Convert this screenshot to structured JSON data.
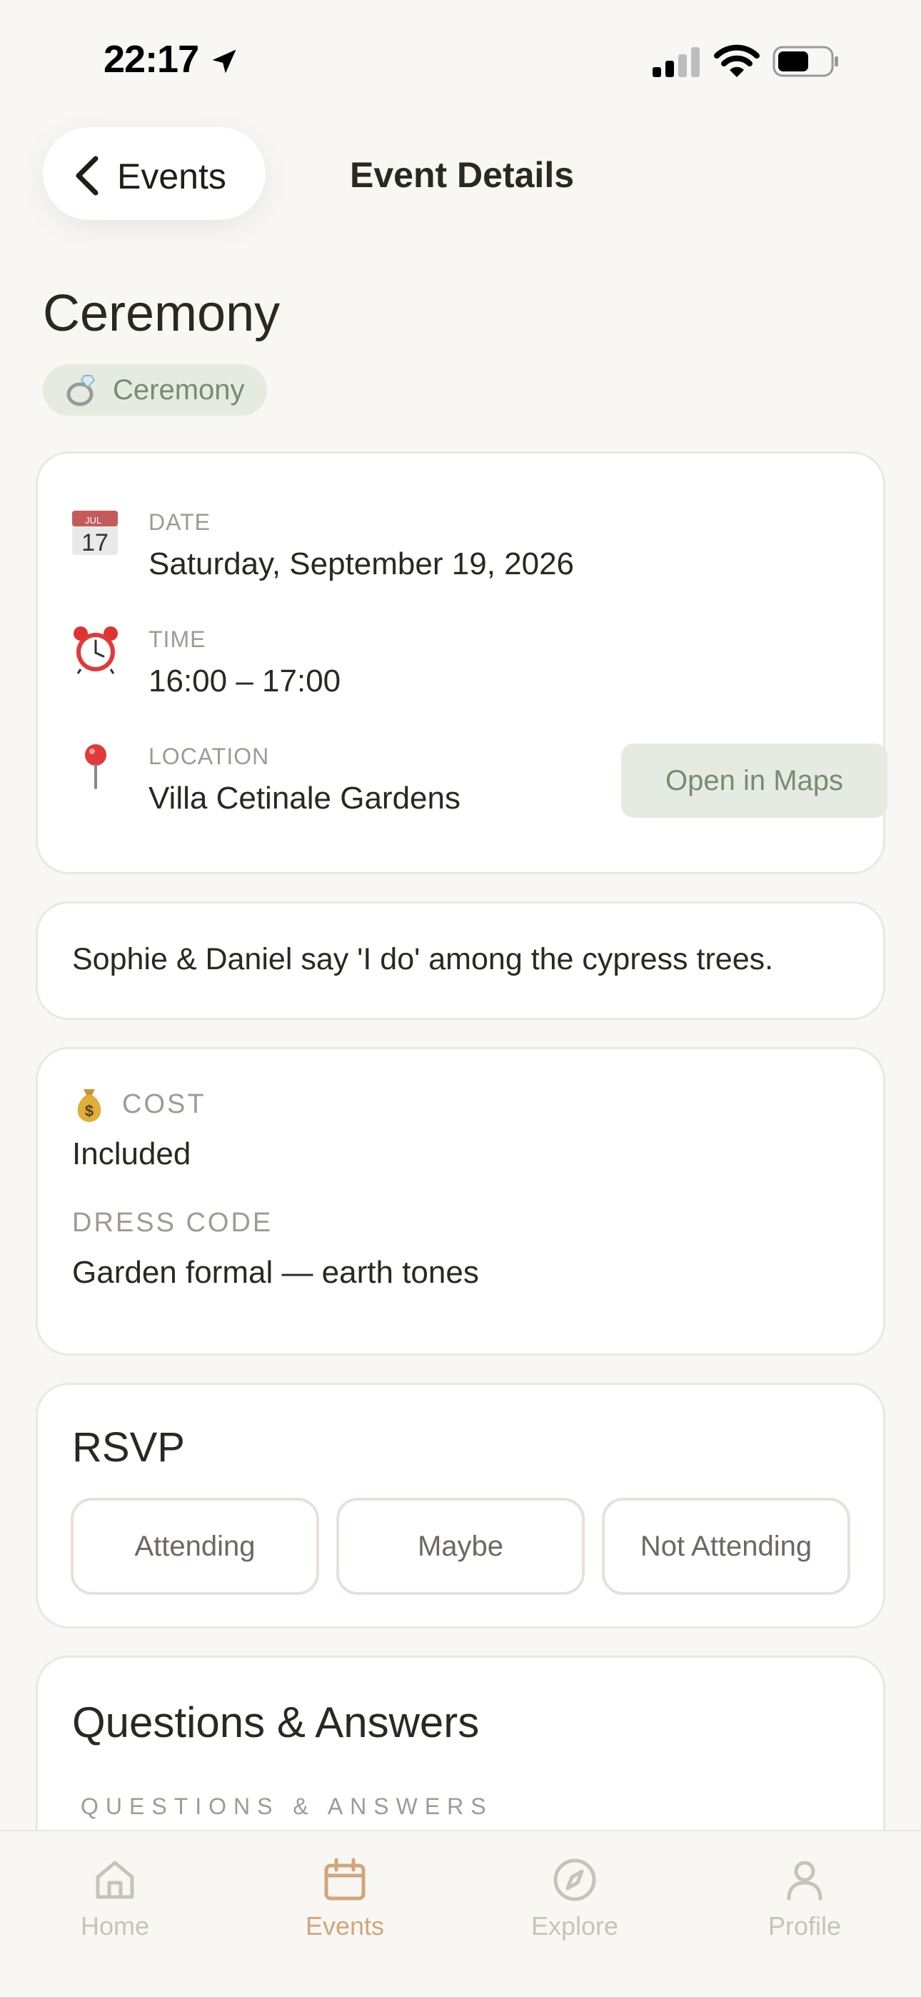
{
  "status_bar": {
    "time": "22:17",
    "icons": [
      "location-arrow-icon",
      "cellular-signal-icon",
      "wifi-icon",
      "battery-icon"
    ]
  },
  "nav": {
    "back_label": "Events",
    "title": "Event Details"
  },
  "event": {
    "title": "Ceremony",
    "category_label": "Ceremony",
    "category_icon": "ring-icon"
  },
  "details": {
    "date": {
      "label": "DATE",
      "value": "Saturday, September 19, 2026",
      "icon": "calendar-icon",
      "icon_month": "JUL",
      "icon_day": "17"
    },
    "time": {
      "label": "TIME",
      "value": "16:00 – 17:00",
      "icon": "alarm-clock-icon"
    },
    "location": {
      "label": "LOCATION",
      "value": "Villa Cetinale Gardens",
      "icon": "map-pin-icon"
    },
    "maps_button": "Open in Maps"
  },
  "description": "Sophie & Daniel say 'I do' among the cypress trees.",
  "cost": {
    "label": "COST",
    "value": "Included",
    "icon": "money-bag-icon",
    "dress_code_label": "DRESS CODE",
    "dress_code_value": "Garden formal — earth tones"
  },
  "rsvp": {
    "title": "RSVP",
    "options": [
      "Attending",
      "Maybe",
      "Not Attending"
    ]
  },
  "qa": {
    "title": "Questions & Answers",
    "subtitle": "QUESTIONS & ANSWERS"
  },
  "tab_bar": {
    "active": "Events",
    "tabs": [
      {
        "label": "Home",
        "icon": "home-icon"
      },
      {
        "label": "Events",
        "icon": "calendar-icon"
      },
      {
        "label": "Explore",
        "icon": "compass-icon"
      },
      {
        "label": "Profile",
        "icon": "profile-icon"
      }
    ]
  },
  "colors": {
    "background": "#f8f7f4",
    "accent": "#d3a57a",
    "sage": "#7b8a74",
    "sage_light": "#e6ebe2",
    "muted": "#a09a92"
  }
}
